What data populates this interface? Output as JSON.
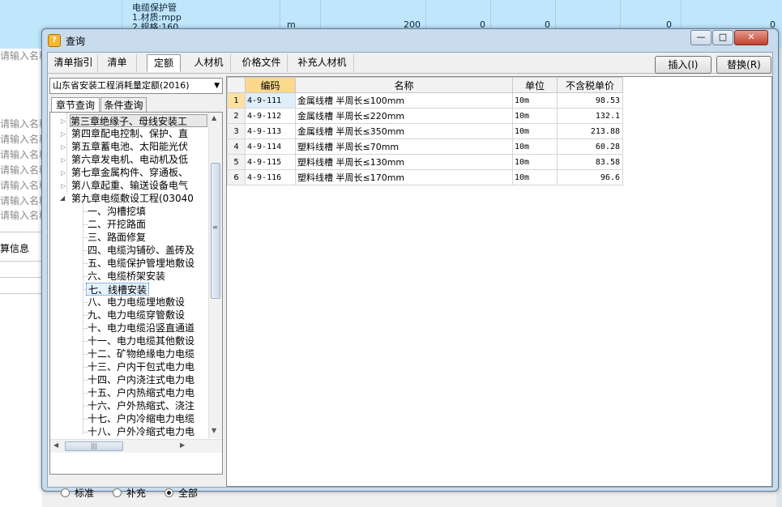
{
  "background": {
    "desc_lines": [
      "电缆保护管",
      "1.材质:mpp",
      "2.规格:160"
    ],
    "cells": [
      "m",
      "200",
      "0",
      "0",
      "0",
      "0"
    ],
    "left_placeholders": [
      "请输入名称",
      "请输入名称",
      "请输入名称",
      "请输入名称",
      "请输入名称",
      "请输入名称",
      "请输入名称",
      "请输入名称"
    ],
    "calc_label": "算信息"
  },
  "dialog": {
    "title": "查询",
    "icon_glyph": "?",
    "btn_min": "—",
    "btn_max": "□",
    "btn_close": "✕"
  },
  "tabs": [
    "清单指引",
    "清单",
    "定额",
    "人材机",
    "价格文件",
    "补充人材机"
  ],
  "actions": {
    "insert": "插入(I)",
    "replace": "替换(R)"
  },
  "left": {
    "quota_select": "山东省安装工程消耗量定额(2016)",
    "subtabs": [
      "章节查询",
      "条件查询"
    ],
    "tree": [
      "第三章绝缘子、母线安装工",
      "第四章配电控制、保护、直",
      "第五章蓄电池、太阳能光伏",
      "第六章发电机、电动机及低",
      "第七章金属构件、穿通板、",
      "第八章起重、输送设备电气",
      "第九章电缆敷设工程(03040",
      "一、沟槽挖填",
      "二、开挖路面",
      "三、路面修复",
      "四、电缆沟铺砂、盖砖及",
      "五、电缆保护管埋地敷设",
      "六、电缆桥架安装",
      "七、线槽安装",
      "八、电力电缆埋地敷设",
      "九、电力电缆穿管敷设",
      "十、电力电缆沿竖直通道",
      "十一、电力电缆其他敷设",
      "十二、矿物绝缘电力电缆",
      "十三、户内干包式电力电",
      "十四、户内浇注式电力电",
      "十五、户内热缩式电力电",
      "十六、户外热缩式、浇注",
      "十七、户内冷缩电力电缆",
      "十八、户外冷缩式电力电"
    ],
    "scroll_up": "▲",
    "scroll_down": "▼",
    "scroll_left": "◀",
    "scroll_right": "▶",
    "hthumb_grip": "|||",
    "vthumb_grip": "≡",
    "radios": [
      "标准",
      "补充",
      "全部"
    ],
    "radio_selected": 2
  },
  "grid": {
    "columns": [
      "编码",
      "名称",
      "单位",
      "不含税单价"
    ],
    "rows": [
      {
        "no": "1",
        "code": "4-9-111",
        "name": "金属线槽 半周长≤100mm",
        "unit": "10m",
        "price": "98.53"
      },
      {
        "no": "2",
        "code": "4-9-112",
        "name": "金属线槽 半周长≤220mm",
        "unit": "10m",
        "price": "132.1"
      },
      {
        "no": "3",
        "code": "4-9-113",
        "name": "金属线槽 半周长≤350mm",
        "unit": "10m",
        "price": "213.88"
      },
      {
        "no": "4",
        "code": "4-9-114",
        "name": "塑料线槽 半周长≤70mm",
        "unit": "10m",
        "price": "60.28"
      },
      {
        "no": "5",
        "code": "4-9-115",
        "name": "塑料线槽 半周长≤130mm",
        "unit": "10m",
        "price": "83.58"
      },
      {
        "no": "6",
        "code": "4-9-116",
        "name": "塑料线槽 半周长≤170mm",
        "unit": "10m",
        "price": "96.6"
      }
    ]
  },
  "colors": {
    "background_row": "#bfe6fb",
    "dialog_frame": "#c9dcee",
    "header_sorted": "#fbd98a",
    "selection": "#deeefb"
  }
}
